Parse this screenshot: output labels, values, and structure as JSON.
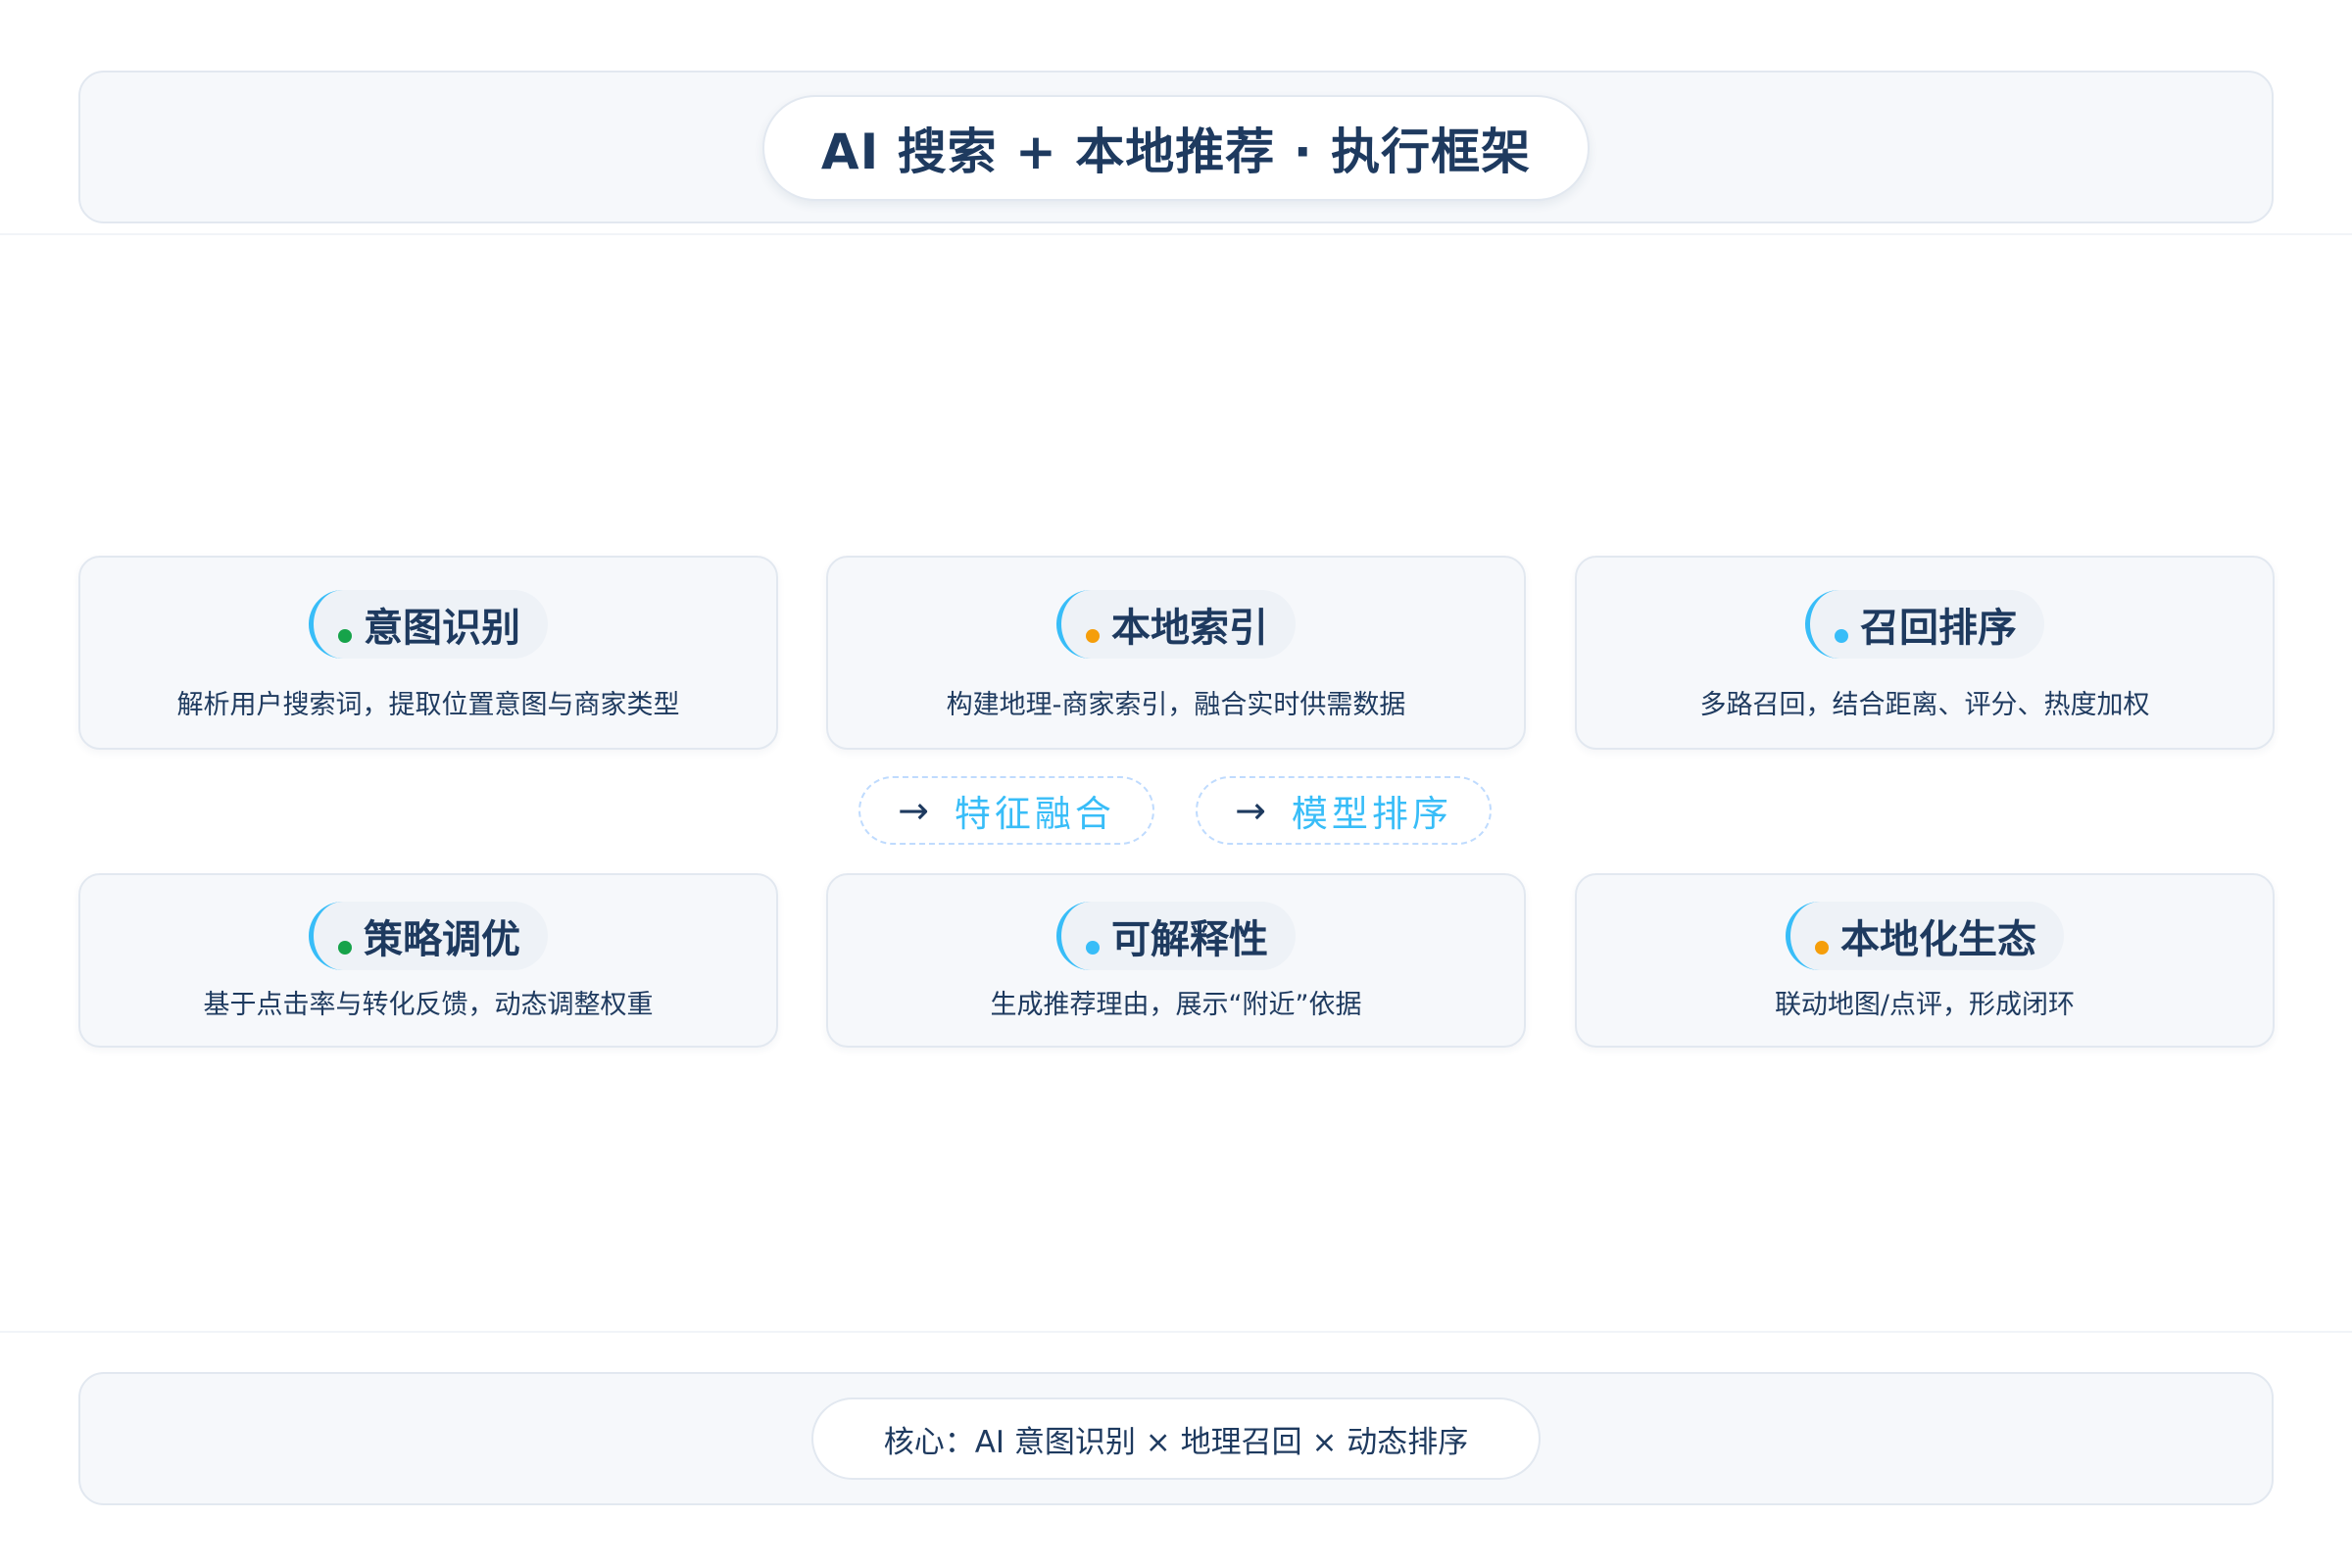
{
  "header": {
    "title": "AI 搜索 + 本地推荐 · 执行框架"
  },
  "cards": [
    {
      "title": "意图识别",
      "desc": "解析用户搜索词，提取位置意图与商家类型",
      "dot_color": "#16a34a"
    },
    {
      "title": "本地索引",
      "desc": "构建地理-商家索引，融合实时供需数据",
      "dot_color": "#f59e0b"
    },
    {
      "title": "召回排序",
      "desc": "多路召回，结合距离、评分、热度加权",
      "dot_color": "#38bdf8"
    },
    {
      "title": "策略调优",
      "desc": "基于点击率与转化反馈，动态调整权重",
      "dot_color": "#16a34a"
    },
    {
      "title": "可解释性",
      "desc": "生成推荐理由，展示“附近”依据",
      "dot_color": "#38bdf8"
    },
    {
      "title": "本地化生态",
      "desc": "联动地图/点评，形成闭环",
      "dot_color": "#f59e0b"
    }
  ],
  "flow": [
    {
      "arrow": "→",
      "label": "特征融合"
    },
    {
      "arrow": "→",
      "label": "模型排序"
    }
  ],
  "footer": {
    "core": "核心：AI 意图识别 × 地理召回 × 动态排序"
  },
  "colors": {
    "accent": "#38bdf8",
    "text": "#1e3a5f",
    "green": "#16a34a",
    "orange": "#f59e0b"
  }
}
